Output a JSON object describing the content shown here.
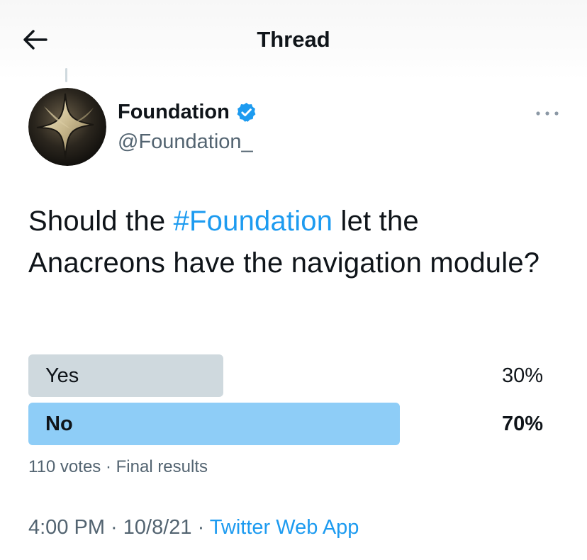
{
  "header": {
    "title": "Thread",
    "back_icon": "arrow-left-icon"
  },
  "author": {
    "name": "Foundation",
    "handle": "@Foundation_",
    "verified_icon": "verified-badge-icon",
    "more_icon": "more-horizontal-icon"
  },
  "tweet": {
    "text_prefix": "Should the ",
    "hashtag": "#Foundation",
    "text_suffix": " let the Anacreons have the navigation module?"
  },
  "poll": {
    "options": [
      {
        "label": "Yes",
        "percent_label": "30%",
        "percent": 30,
        "winner": false,
        "bar_color": "#cfd9de"
      },
      {
        "label": "No",
        "percent_label": "70%",
        "percent": 70,
        "winner": true,
        "bar_color": "#8ecdf7"
      }
    ],
    "votes": "110 votes",
    "separator": " · ",
    "status": "Final results"
  },
  "meta": {
    "time": "4:00 PM",
    "date": "10/8/21",
    "separator": " · ",
    "source": "Twitter Web App"
  },
  "colors": {
    "accent": "#1d9bf0",
    "text_primary": "#0f1419",
    "text_secondary": "#536471"
  }
}
